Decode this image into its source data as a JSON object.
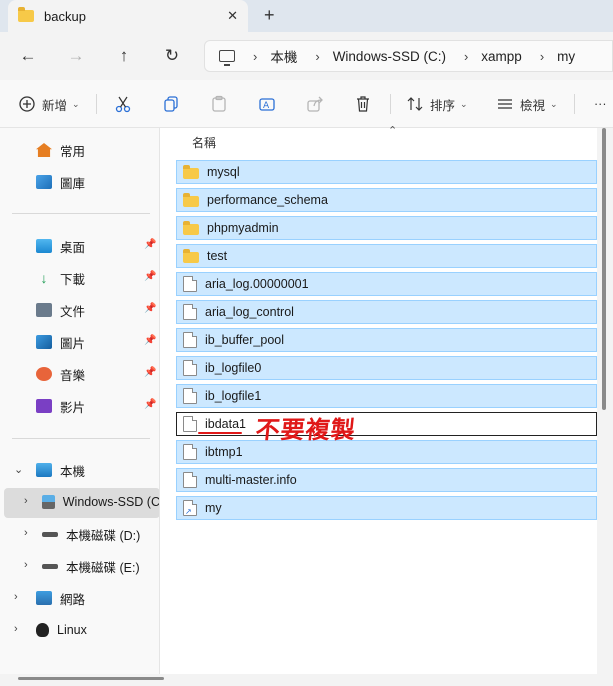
{
  "window": {
    "tab_title": "backup",
    "new_tab": "+",
    "close_tab": "✕"
  },
  "address": {
    "crumbs": [
      "本機",
      "Windows-SSD (C:)",
      "xampp",
      "my"
    ]
  },
  "toolbar": {
    "new_label": "新增",
    "sort_label": "排序",
    "view_label": "檢視",
    "more_label": "···"
  },
  "sidebar": {
    "items": [
      {
        "label": "常用",
        "icon": "home-icon"
      },
      {
        "label": "圖庫",
        "icon": "gallery-icon"
      },
      {
        "label": "桌面",
        "icon": "desktop-icon",
        "pinned": true
      },
      {
        "label": "下載",
        "icon": "download-icon",
        "pinned": true
      },
      {
        "label": "文件",
        "icon": "documents-icon",
        "pinned": true
      },
      {
        "label": "圖片",
        "icon": "pictures-icon",
        "pinned": true
      },
      {
        "label": "音樂",
        "icon": "music-icon",
        "pinned": true
      },
      {
        "label": "影片",
        "icon": "videos-icon",
        "pinned": true
      },
      {
        "label": "本機",
        "icon": "this-pc-icon"
      },
      {
        "label": "Windows-SSD (C",
        "icon": "drive-c-icon"
      },
      {
        "label": "本機磁碟 (D:)",
        "icon": "drive-icon"
      },
      {
        "label": "本機磁碟 (E:)",
        "icon": "drive-icon"
      },
      {
        "label": "網路",
        "icon": "network-icon"
      },
      {
        "label": "Linux",
        "icon": "linux-icon"
      }
    ]
  },
  "content": {
    "column_name": "名稱",
    "files": [
      {
        "name": "mysql",
        "type": "folder"
      },
      {
        "name": "performance_schema",
        "type": "folder"
      },
      {
        "name": "phpmyadmin",
        "type": "folder"
      },
      {
        "name": "test",
        "type": "folder"
      },
      {
        "name": "aria_log.00000001",
        "type": "file"
      },
      {
        "name": "aria_log_control",
        "type": "file"
      },
      {
        "name": "ib_buffer_pool",
        "type": "file"
      },
      {
        "name": "ib_logfile0",
        "type": "file"
      },
      {
        "name": "ib_logfile1",
        "type": "file"
      },
      {
        "name": "ibdata1",
        "type": "file"
      },
      {
        "name": "ibtmp1",
        "type": "file"
      },
      {
        "name": "multi-master.info",
        "type": "file"
      },
      {
        "name": "my",
        "type": "shortcut"
      }
    ],
    "annotation": "不要複製"
  },
  "colors": {
    "selection": "#cce8ff",
    "selection_border": "#99d1ff",
    "annotation": "#e01818",
    "folder": "#f7c948"
  }
}
